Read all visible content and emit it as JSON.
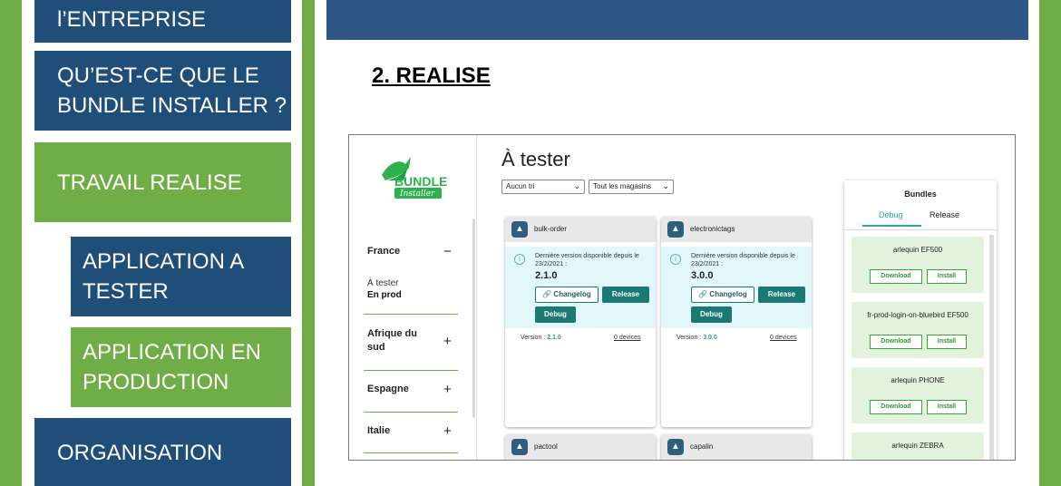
{
  "nav": {
    "entreprise": "l’ENTREPRISE",
    "bundle_installer": [
      "QU’EST-CE QUE LE",
      "BUNDLE INSTALLER ?"
    ],
    "travail_realise": "TRAVAIL REALISE",
    "application_a_tester": [
      "APPLICATION A",
      "TESTER"
    ],
    "application_en_production": [
      "APPLICATION EN",
      "PRODUCTION"
    ],
    "organisation": "ORGANISATION"
  },
  "content": {
    "heading": "2. REALISE"
  },
  "app": {
    "logo": {
      "word1": "BUNDLE",
      "word2": "Installer"
    },
    "title": "À tester",
    "sort_select": "Aucun tri",
    "store_select": "Tout les magasins",
    "sidebar": {
      "countries": [
        {
          "name": "France",
          "symbol": "−"
        },
        {
          "name": "Afrique du sud",
          "symbol": "+"
        },
        {
          "name": "Espagne",
          "symbol": "+"
        },
        {
          "name": "Italie",
          "symbol": "+"
        }
      ],
      "france_sub": [
        "À tester",
        "En prod"
      ]
    },
    "cards": [
      {
        "name": "bulk-order",
        "since": "Dernière version disponible depuis le 23/2/2021 :",
        "version": "2.1.0",
        "changelog": "Changelog",
        "release": "Release",
        "debug": "Debug",
        "version_label": "Version :",
        "version_value": "2.1.0",
        "devices": "0 devices"
      },
      {
        "name": "electronictags",
        "since": "Dernière version disponible depuis le 23/2/2021 :",
        "version": "3.0.0",
        "changelog": "Changelog",
        "release": "Release",
        "debug": "Debug",
        "version_label": "Version :",
        "version_value": "3.0.0",
        "devices": "0 devices"
      },
      {
        "name": "pactool"
      },
      {
        "name": "capalin"
      }
    ],
    "bundles": {
      "title": "Bundles",
      "tabs": [
        "Debug",
        "Release"
      ],
      "items": [
        {
          "name": "arlequin EF500",
          "download": "Download",
          "install": "Install"
        },
        {
          "name": "fr-prod-login-on-bluebird EF500",
          "download": "Download",
          "install": "Install"
        },
        {
          "name": "arlequin PHONE",
          "download": "Download",
          "install": "Install"
        },
        {
          "name": "arlequin ZEBRA"
        }
      ]
    }
  },
  "colors": {
    "green": "#70ad47",
    "blue": "#1f4e79",
    "teal": "#1a7a73"
  }
}
